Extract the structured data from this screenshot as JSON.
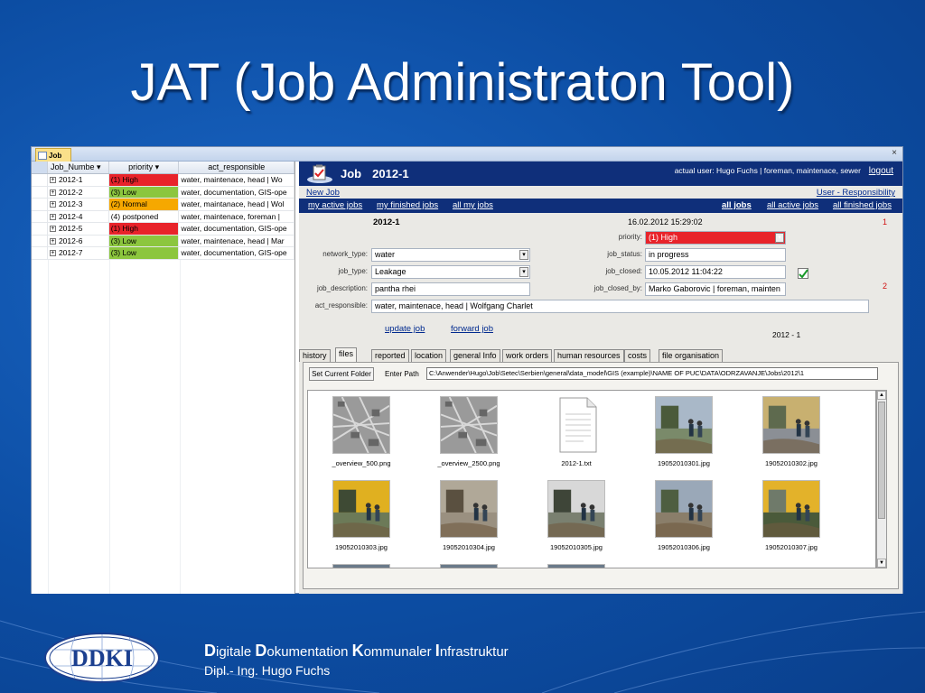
{
  "slide": {
    "title": "JAT (Job Administraton Tool)",
    "footer": {
      "w1_initial": "D",
      "w1_rest": "igitale ",
      "w2_initial": "D",
      "w2_rest": "okumentation ",
      "w3_initial": "K",
      "w3_rest": "ommunaler ",
      "w4_initial": "I",
      "w4_rest": "nfrastruktur",
      "author": "Dipl.- Ing. Hugo Fuchs",
      "logo_text": "DDKI"
    }
  },
  "app": {
    "tab_label": "Job",
    "close_glyph": "×"
  },
  "list": {
    "headers": [
      "Job_Numbe",
      "priority",
      "act_responsible"
    ],
    "rows": [
      {
        "id": "2012-1",
        "priority": "(1) High",
        "responsible": "water, maintenace, head | Wo"
      },
      {
        "id": "2012-2",
        "priority": "(3) Low",
        "responsible": "water, documentation, GIS-ope"
      },
      {
        "id": "2012-3",
        "priority": "(2) Normal",
        "responsible": "water, maintanace, head | Wol"
      },
      {
        "id": "2012-4",
        "priority": "(4) postponed",
        "responsible": "water, maintenace, foreman |"
      },
      {
        "id": "2012-5",
        "priority": "(1) High",
        "responsible": "water, documentation, GIS-ope"
      },
      {
        "id": "2012-6",
        "priority": "(3) Low",
        "responsible": "water, maintenace, head | Mar"
      },
      {
        "id": "2012-7",
        "priority": "(3) Low",
        "responsible": "water, documentation, GIS-ope"
      }
    ],
    "priority_colors": {
      "(1) High": "#e8232a",
      "(2) Normal": "#f6a800",
      "(3) Low": "#8cc63e",
      "(4) postponed": "#ffffff"
    }
  },
  "form": {
    "title": "Job",
    "job_number": "2012-1",
    "user": "actual user: Hugo Fuchs | foreman, maintenace, sewer",
    "logout": "logout",
    "new_job": "New Job",
    "user_responsibility": "User - Responsibility",
    "nav": {
      "my_active": "my active jobs",
      "my_finished": "my finished jobs",
      "all_my": "all my jobs",
      "all_jobs": "all jobs",
      "all_active": "all active jobs",
      "all_finished": "all finished jobs"
    },
    "header_number": "2012-1",
    "header_date": "16.02.2012 15:29:02",
    "marker1": "1",
    "marker2": "2",
    "labels": {
      "priority": "priority:",
      "network_type": "network_type:",
      "job_status": "job_status:",
      "job_type": "job_type:",
      "job_closed": "job_closed:",
      "job_description": "job_description:",
      "job_closed_by": "job_closed_by:",
      "act_responsible": "act_responsible:"
    },
    "values": {
      "priority": "(1) High",
      "network_type": "water",
      "job_status": "in progress",
      "job_type": "Leakage",
      "job_closed": "10.05.2012 11:04:22",
      "job_description": "pantha rhei",
      "job_closed_by": "Marko Gaborovic | foreman, mainten",
      "act_responsible": "water, maintenace, head | Wolfgang Charlet"
    },
    "update_job": "update job",
    "forward_job": "forward job",
    "counter": "2012  - 1",
    "tabs": [
      "history",
      "files",
      "reported",
      "location",
      "general Info",
      "work orders",
      "human resources",
      "costs",
      "file organisation"
    ],
    "active_tab": "files",
    "set_current_folder": "Set Current Folder",
    "enter_path": "Enter Path",
    "path_value": "C:\\Anwender\\Hugo\\Job\\Setec\\Serbien\\general\\data_model\\GIS (example)\\NAME OF PUC\\DATA\\ODRZAVANJE\\Jobs\\2012\\1",
    "files": [
      {
        "name": "_overview_500.png",
        "kind": "map"
      },
      {
        "name": "_overview_2500.png",
        "kind": "map"
      },
      {
        "name": "2012-1.txt",
        "kind": "doc"
      },
      {
        "name": "19052010301.jpg",
        "kind": "photo"
      },
      {
        "name": "19052010302.jpg",
        "kind": "photo"
      },
      {
        "name": "19052010303.jpg",
        "kind": "photo"
      },
      {
        "name": "19052010304.jpg",
        "kind": "photo"
      },
      {
        "name": "19052010305.jpg",
        "kind": "photo"
      },
      {
        "name": "19052010306.jpg",
        "kind": "photo"
      },
      {
        "name": "19052010307.jpg",
        "kind": "photo"
      }
    ],
    "colors": {
      "header": "#0f2f7a",
      "priority_high": "#e8232a"
    }
  }
}
